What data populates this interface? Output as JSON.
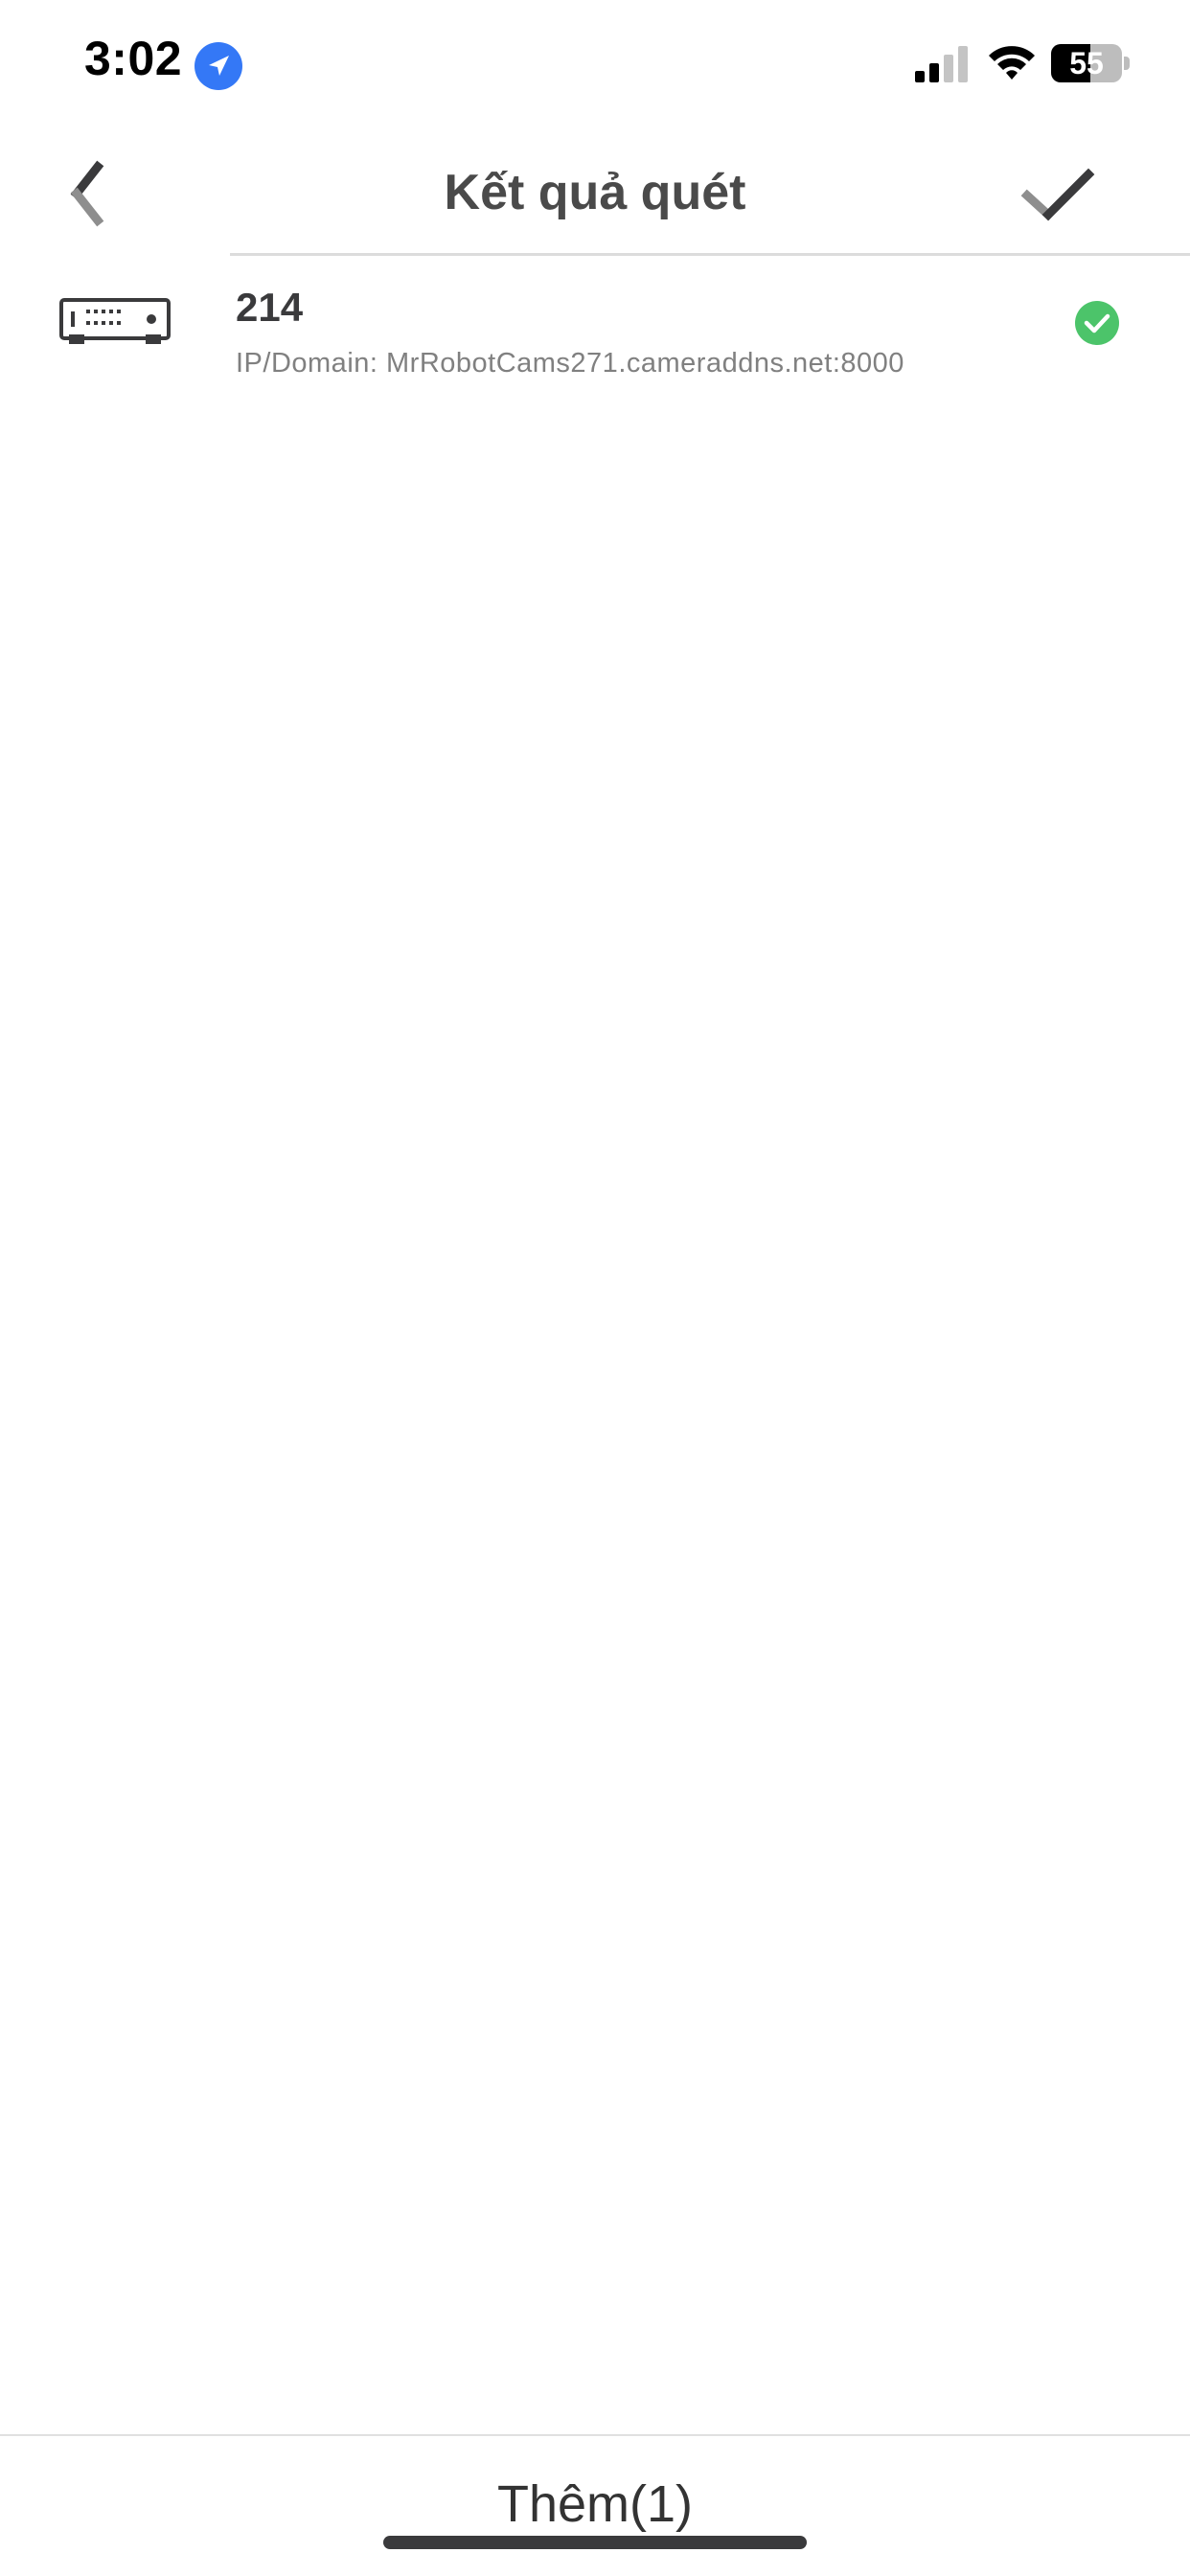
{
  "status_bar": {
    "time": "3:02",
    "battery_level": "55",
    "battery_fill_fraction": 0.55,
    "icons": [
      "location-arrow-icon",
      "cellular-signal-icon",
      "wifi-icon",
      "battery-icon"
    ]
  },
  "nav": {
    "title": "Kết quả quét",
    "back_icon": "chevron-left-icon",
    "confirm_icon": "checkmark-icon"
  },
  "devices": [
    {
      "name": "214",
      "address": "IP/Domain: MrRobotCams271.cameraddns.net:8000",
      "icon": "recorder-device-icon",
      "selected": true
    }
  ],
  "footer": {
    "add_label": "Thêm(1)"
  },
  "colors": {
    "accent_blue": "#3478f6",
    "check_green": "#4cc46a",
    "icon_dark": "#3a3a3c",
    "subtext_gray": "#808080"
  }
}
